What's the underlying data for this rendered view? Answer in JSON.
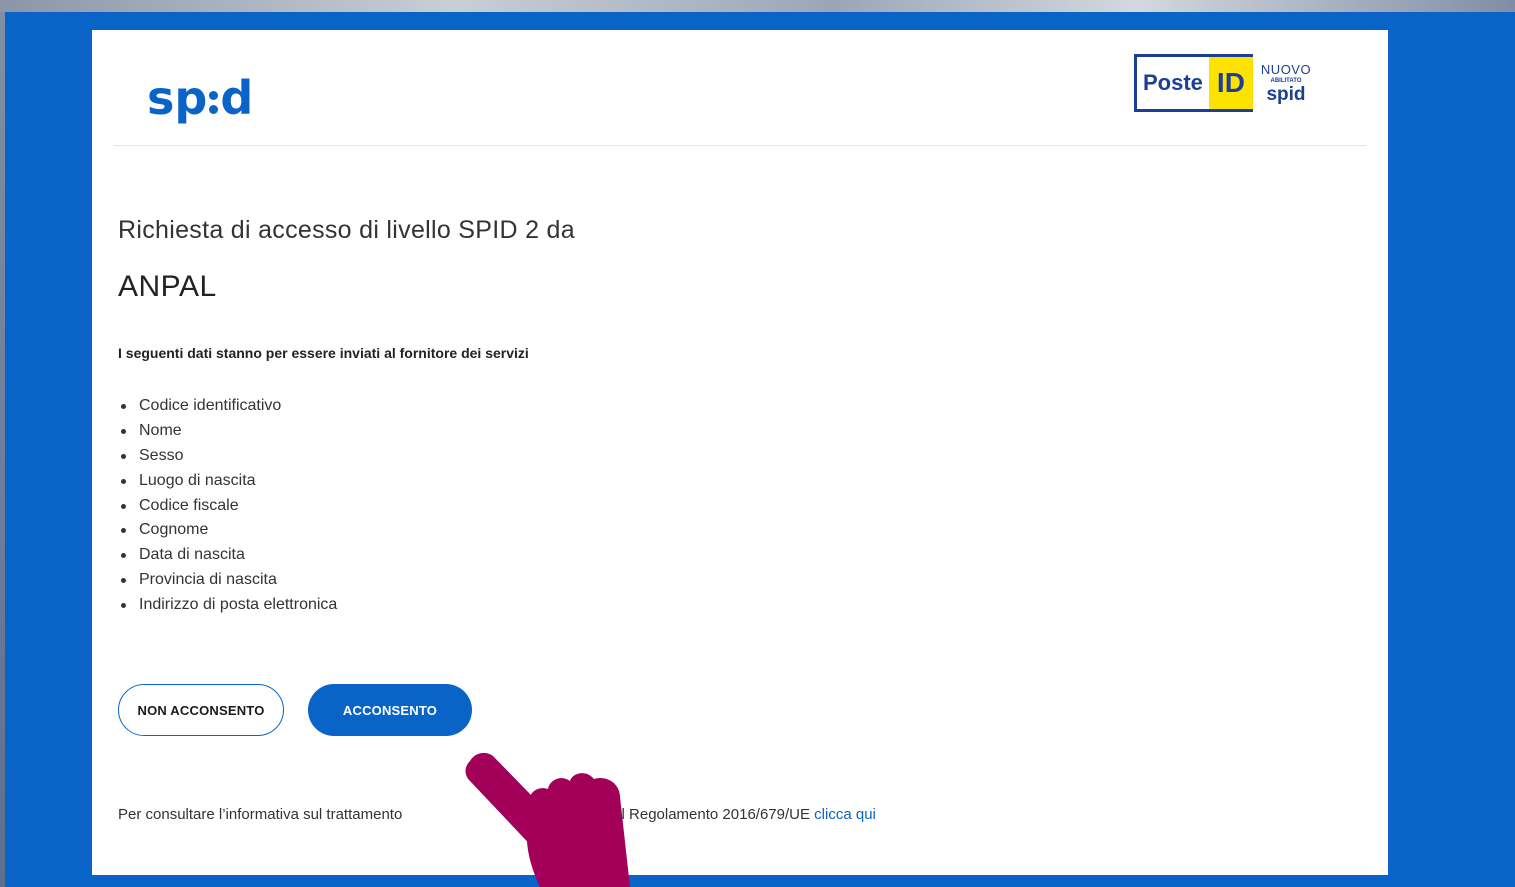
{
  "brand": {
    "spid_logo_left": "sp",
    "spid_logo_right": "d",
    "provider_logo": {
      "poste": "Poste",
      "id": "ID",
      "nuovo": "NUOVO",
      "abilitato": "ABILITATO",
      "spid": "spid"
    }
  },
  "request": {
    "title": "Richiesta di accesso di livello SPID 2 da",
    "service_provider": "ANPAL",
    "data_intro": "I seguenti dati stanno per essere inviati al fornitore dei servizi",
    "attributes": [
      "Codice identificativo",
      "Nome",
      "Sesso",
      "Luogo di nascita",
      "Codice fiscale",
      "Cognome",
      "Data di nascita",
      "Provincia di nascita",
      "Indirizzo di posta elettronica"
    ]
  },
  "actions": {
    "deny_label": "NON ACCONSENTO",
    "allow_label": "ACCONSENTO"
  },
  "footer": {
    "note_start": "Per consultare l’informativa sul trattamento",
    "note_end": "ali ai sensi del Regolamento 2016/679/UE",
    "link_label": "clicca qui"
  },
  "colors": {
    "background": "#0a64c8",
    "accent": "#0a64c8",
    "pointer": "#a3005a",
    "poste_yellow": "#ffe300",
    "poste_blue": "#1c3f95"
  }
}
